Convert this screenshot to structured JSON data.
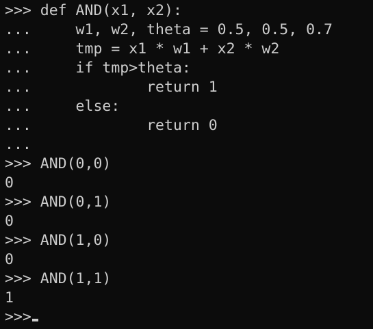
{
  "terminal": {
    "fg_color": "#cccccc",
    "bg_color": "#0c0c0c",
    "lines": [
      ">>> def AND(x1, x2):",
      "...     w1, w2, theta = 0.5, 0.5, 0.7",
      "...     tmp = x1 * w1 + x2 * w2",
      "...     if tmp>theta:",
      "...             return 1",
      "...     else:",
      "...             return 0",
      "...",
      ">>> AND(0,0)",
      "0",
      ">>> AND(0,1)",
      "0",
      ">>> AND(1,0)",
      "0",
      ">>> AND(1,1)",
      "1",
      ">>>"
    ]
  }
}
